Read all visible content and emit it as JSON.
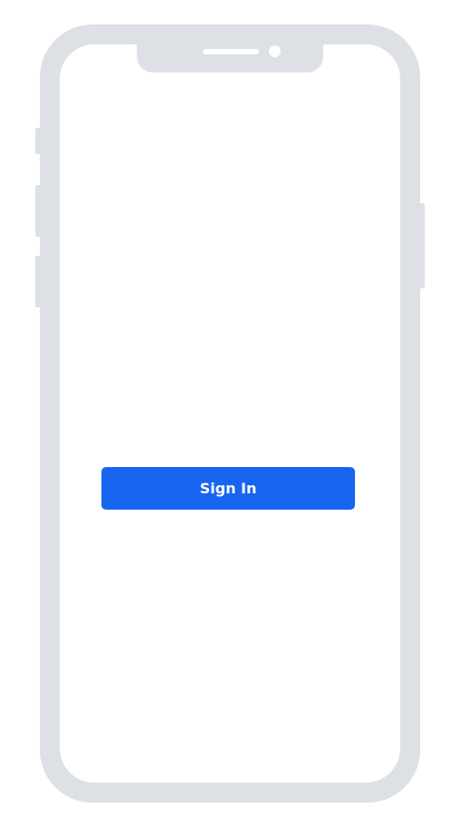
{
  "app": {
    "device": "phone-mockup"
  },
  "colors": {
    "frame": "#dde0e5",
    "screen": "#ffffff",
    "accent": "#1865f2",
    "button_text": "#ffffff"
  },
  "screen": {
    "primary_button_label": "Sign In"
  }
}
